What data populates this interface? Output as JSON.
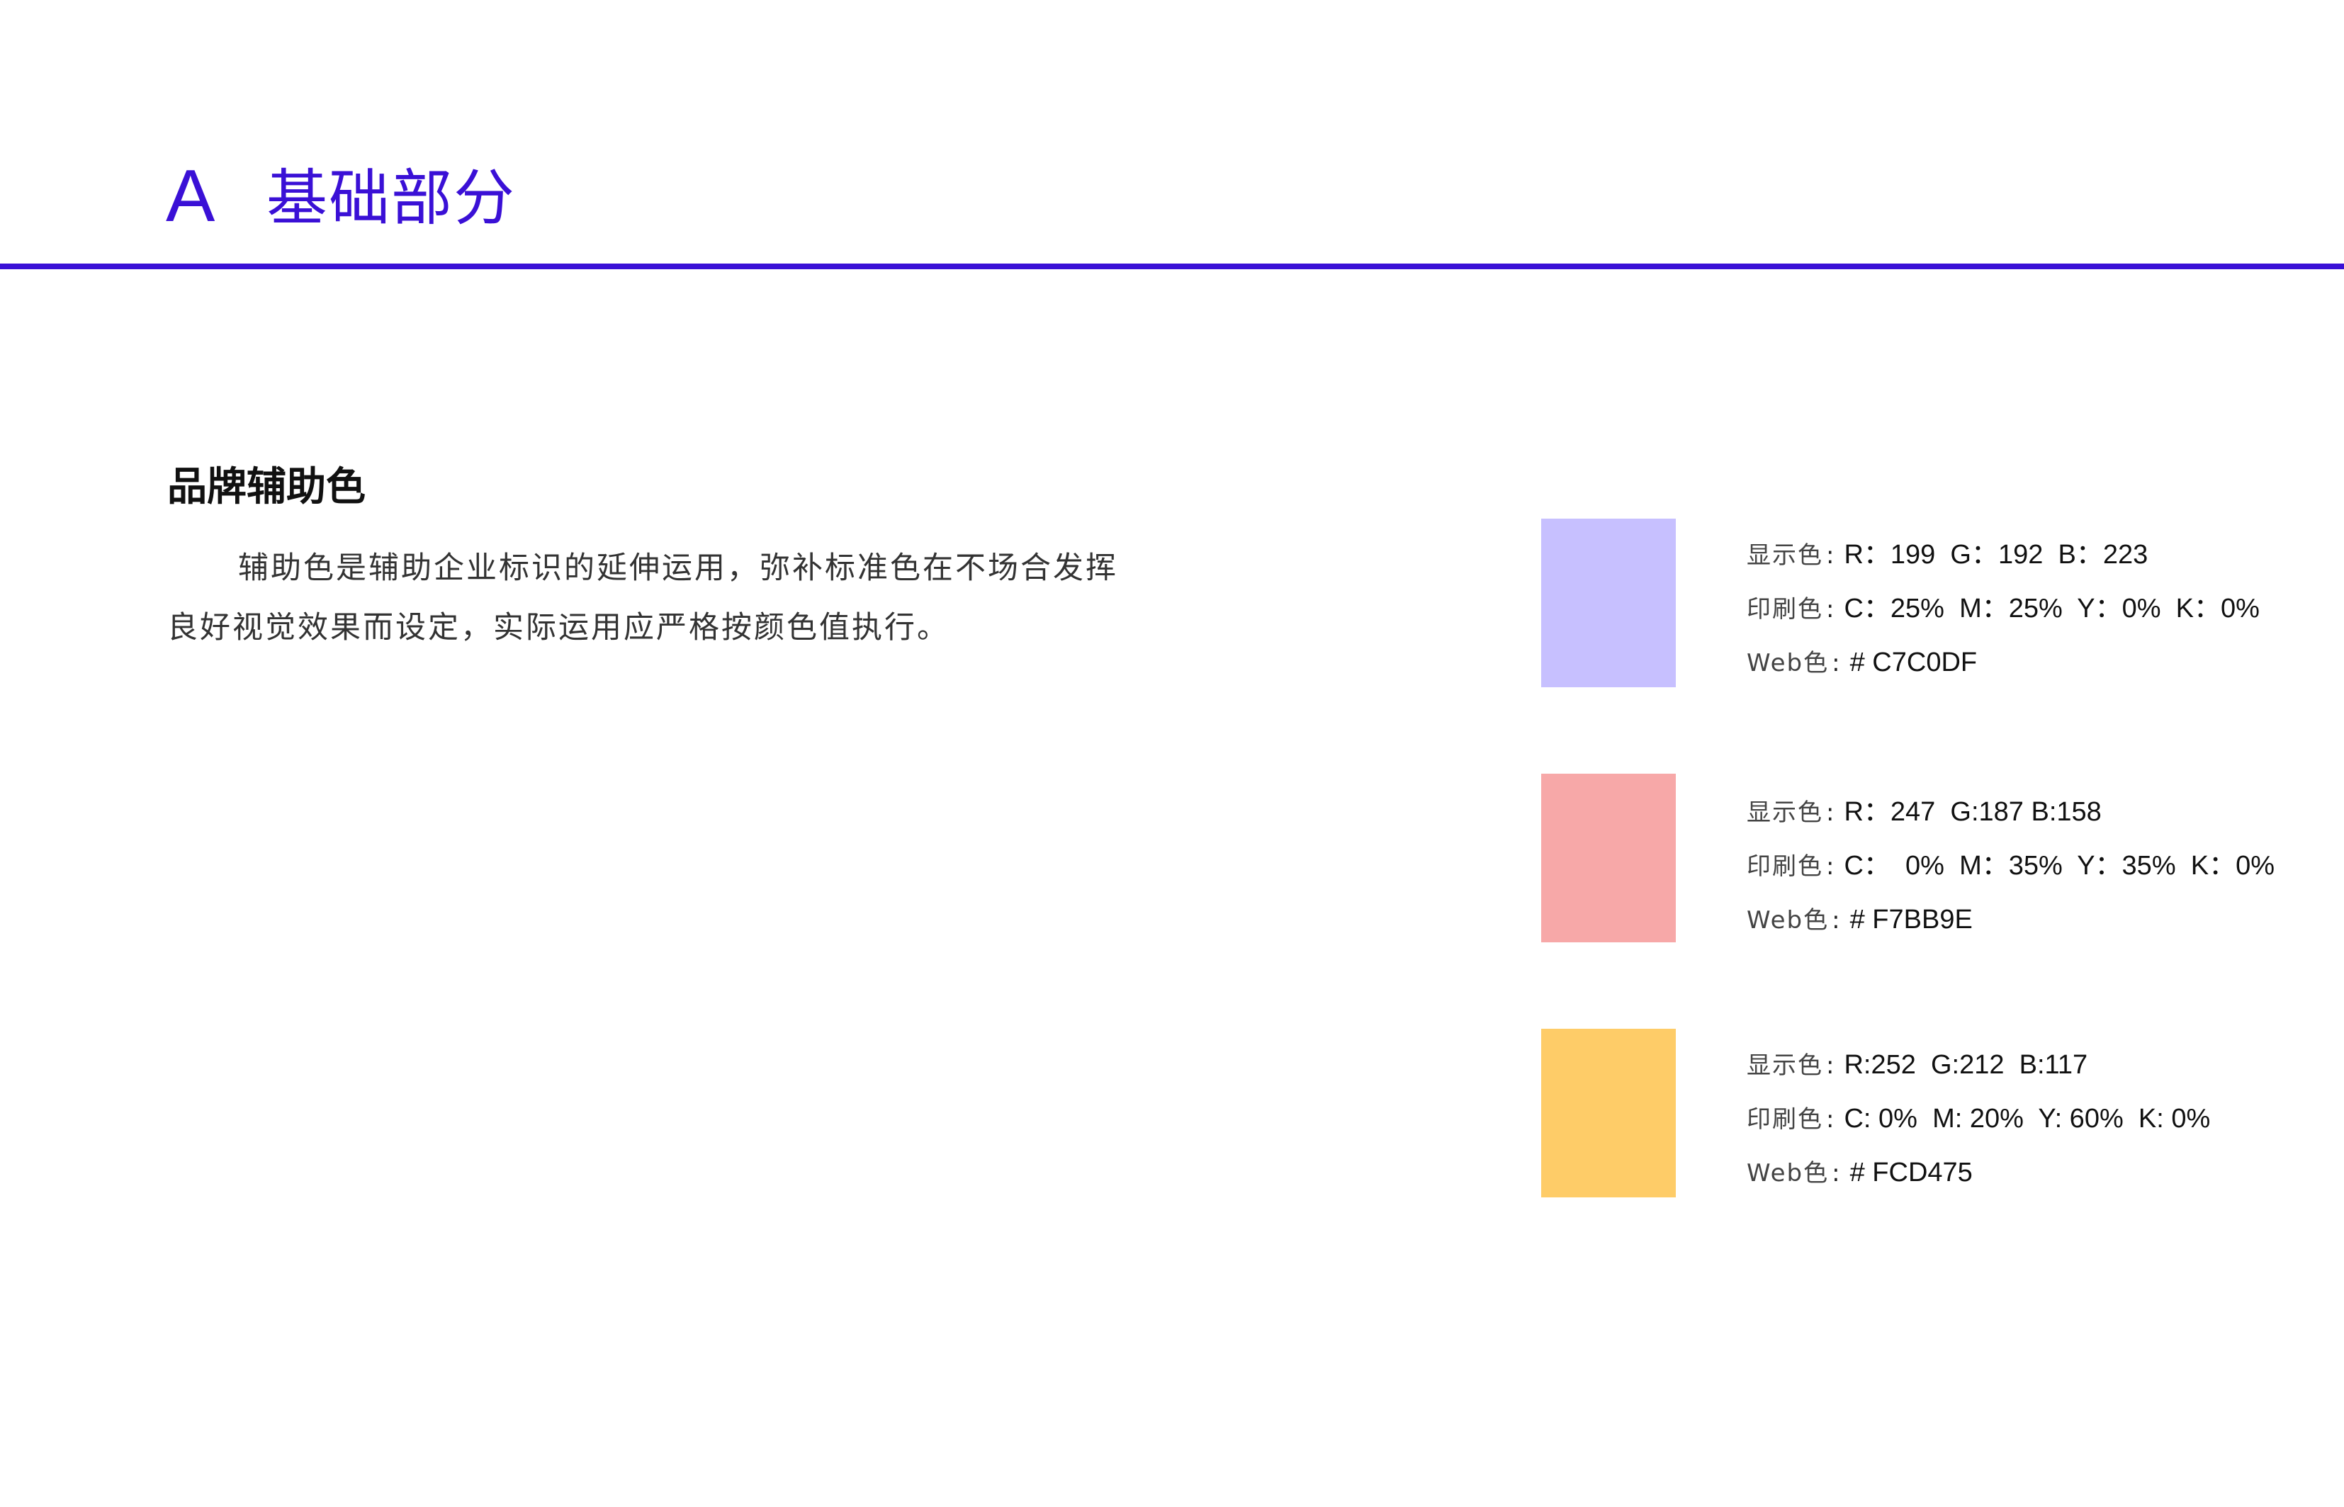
{
  "header": {
    "letter": "A",
    "title": "基础部分",
    "accent_color": "#3a10d6"
  },
  "section": {
    "title": "品牌辅助色",
    "description": "辅助色是辅助企业标识的延伸运用，弥补标准色在不场合发挥良好视觉效果而设定，实际运用应严格按颜色值执行。"
  },
  "colors": [
    {
      "swatch": "#C7C0FF",
      "display_label": "显示色",
      "display_value": "R：199  G：192  B：223",
      "print_label": "印刷色",
      "print_value": "C：25%  M：25%  Y：0%  K：0%",
      "web_label": "Web色",
      "web_value": "# C7C0DF"
    },
    {
      "swatch": "#F7A8A8",
      "display_label": "显示色",
      "display_value": "R：247  G:187 B:158",
      "print_label": "印刷色",
      "print_value": "C：  0%  M：35%  Y：35%  K：0%",
      "web_label": "Web色",
      "web_value": "# F7BB9E"
    },
    {
      "swatch": "#FECC68",
      "display_label": "显示色",
      "display_value": "R:252  G:212  B:117",
      "print_label": "印刷色",
      "print_value": "C: 0%  M: 20%  Y: 60%  K: 0%",
      "web_label": "Web色",
      "web_value": "# FCD475"
    }
  ]
}
